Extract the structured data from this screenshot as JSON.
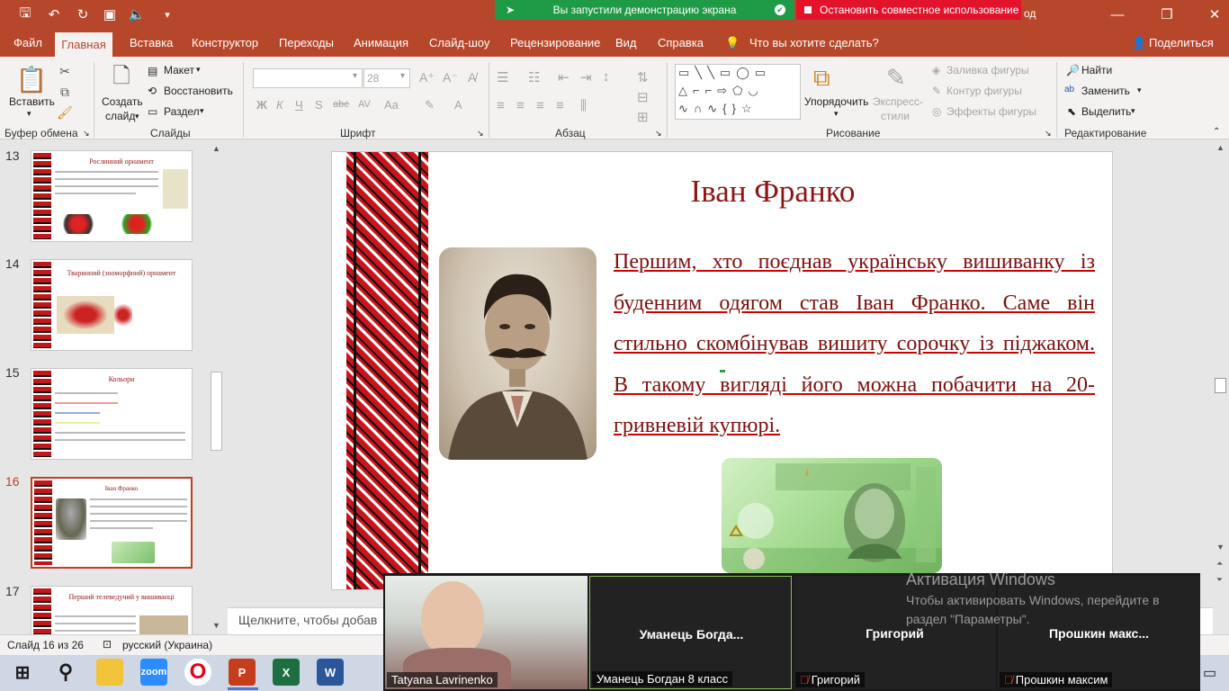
{
  "share": {
    "green_text": "Вы запустили демонстрацию экрана",
    "red_text": "Остановить совместное использование",
    "title_tail": "од"
  },
  "tabs": [
    "Файл",
    "Главная",
    "Вставка",
    "Конструктор",
    "Переходы",
    "Анимация",
    "Слайд-шоу",
    "Рецензирование",
    "Вид",
    "Справка",
    "Что вы хотите сделать?",
    "Поделиться"
  ],
  "ribbon": {
    "clipboard": {
      "paste": "Вставить",
      "label": "Буфер обмена"
    },
    "slides": {
      "create": "Создать",
      "create2": "слайд",
      "layout": "Макет",
      "reset": "Восстановить",
      "section": "Раздел",
      "label": "Слайды"
    },
    "font": {
      "size": "28",
      "label": "Шрифт",
      "bold": "Ж",
      "italic": "К",
      "underline": "Ч",
      "strike": "S",
      "shadow": "abc",
      "spacing": "AV",
      "case": "Aa",
      "color": "A"
    },
    "paragraph": {
      "label": "Абзац"
    },
    "drawing": {
      "arrange": "Упорядочить",
      "quick1": "Экспресс-",
      "quick2": "стили",
      "fill": "Заливка фигуры",
      "outline": "Контур фигуры",
      "effects": "Эффекты фигуры",
      "label": "Рисование"
    },
    "editing": {
      "find": "Найти",
      "replace": "Заменить",
      "select": "Выделить",
      "label": "Редактирование"
    }
  },
  "thumbnails": [
    {
      "num": "13",
      "title": "Рослинний орнамент"
    },
    {
      "num": "14",
      "title": "Тваринний (зооморфний) орнамент"
    },
    {
      "num": "15",
      "title": "Кольори"
    },
    {
      "num": "16",
      "title": "Іван Франко"
    },
    {
      "num": "17",
      "title": "Перший телеведучий у вишиванці"
    }
  ],
  "slide": {
    "title": "Іван Франко",
    "body": "Першим, хто поєднав українську вишиванку із буденним одягом став Іван Франко. Саме він стильно скомбінував вишиту сорочку із піджаком. В такому вигляді його можна побачити на 20-гривневій купюрі."
  },
  "notes_placeholder": "Щелкните, чтобы добав",
  "status": {
    "slide": "Слайд 16 из 26",
    "language": "русский (Украина)"
  },
  "zoom": {
    "tiles": [
      {
        "name": "",
        "label": "Tatyana Lavrinenko",
        "muted": false
      },
      {
        "name": "Уманець  Богда...",
        "label": "Уманець Богдан 8 класс",
        "muted": false
      },
      {
        "name": "Григорий",
        "label": "Григорий",
        "muted": true
      },
      {
        "name": "Прошкин  макс...",
        "label": "Прошкин максим",
        "muted": true
      }
    ]
  },
  "watermark": {
    "title": "Активация Windows",
    "text": "Чтобы активировать Windows, перейдите в раздел \"Параметры\"."
  },
  "taskbar": {
    "zoom_label": "zoom",
    "excel_label": "X",
    "word_label": "W",
    "ppt_label": "P"
  },
  "colors": {
    "accent": "#b7472a",
    "green": "#1f9b47",
    "red": "#e3132b",
    "slide_text": "#7a1010"
  }
}
